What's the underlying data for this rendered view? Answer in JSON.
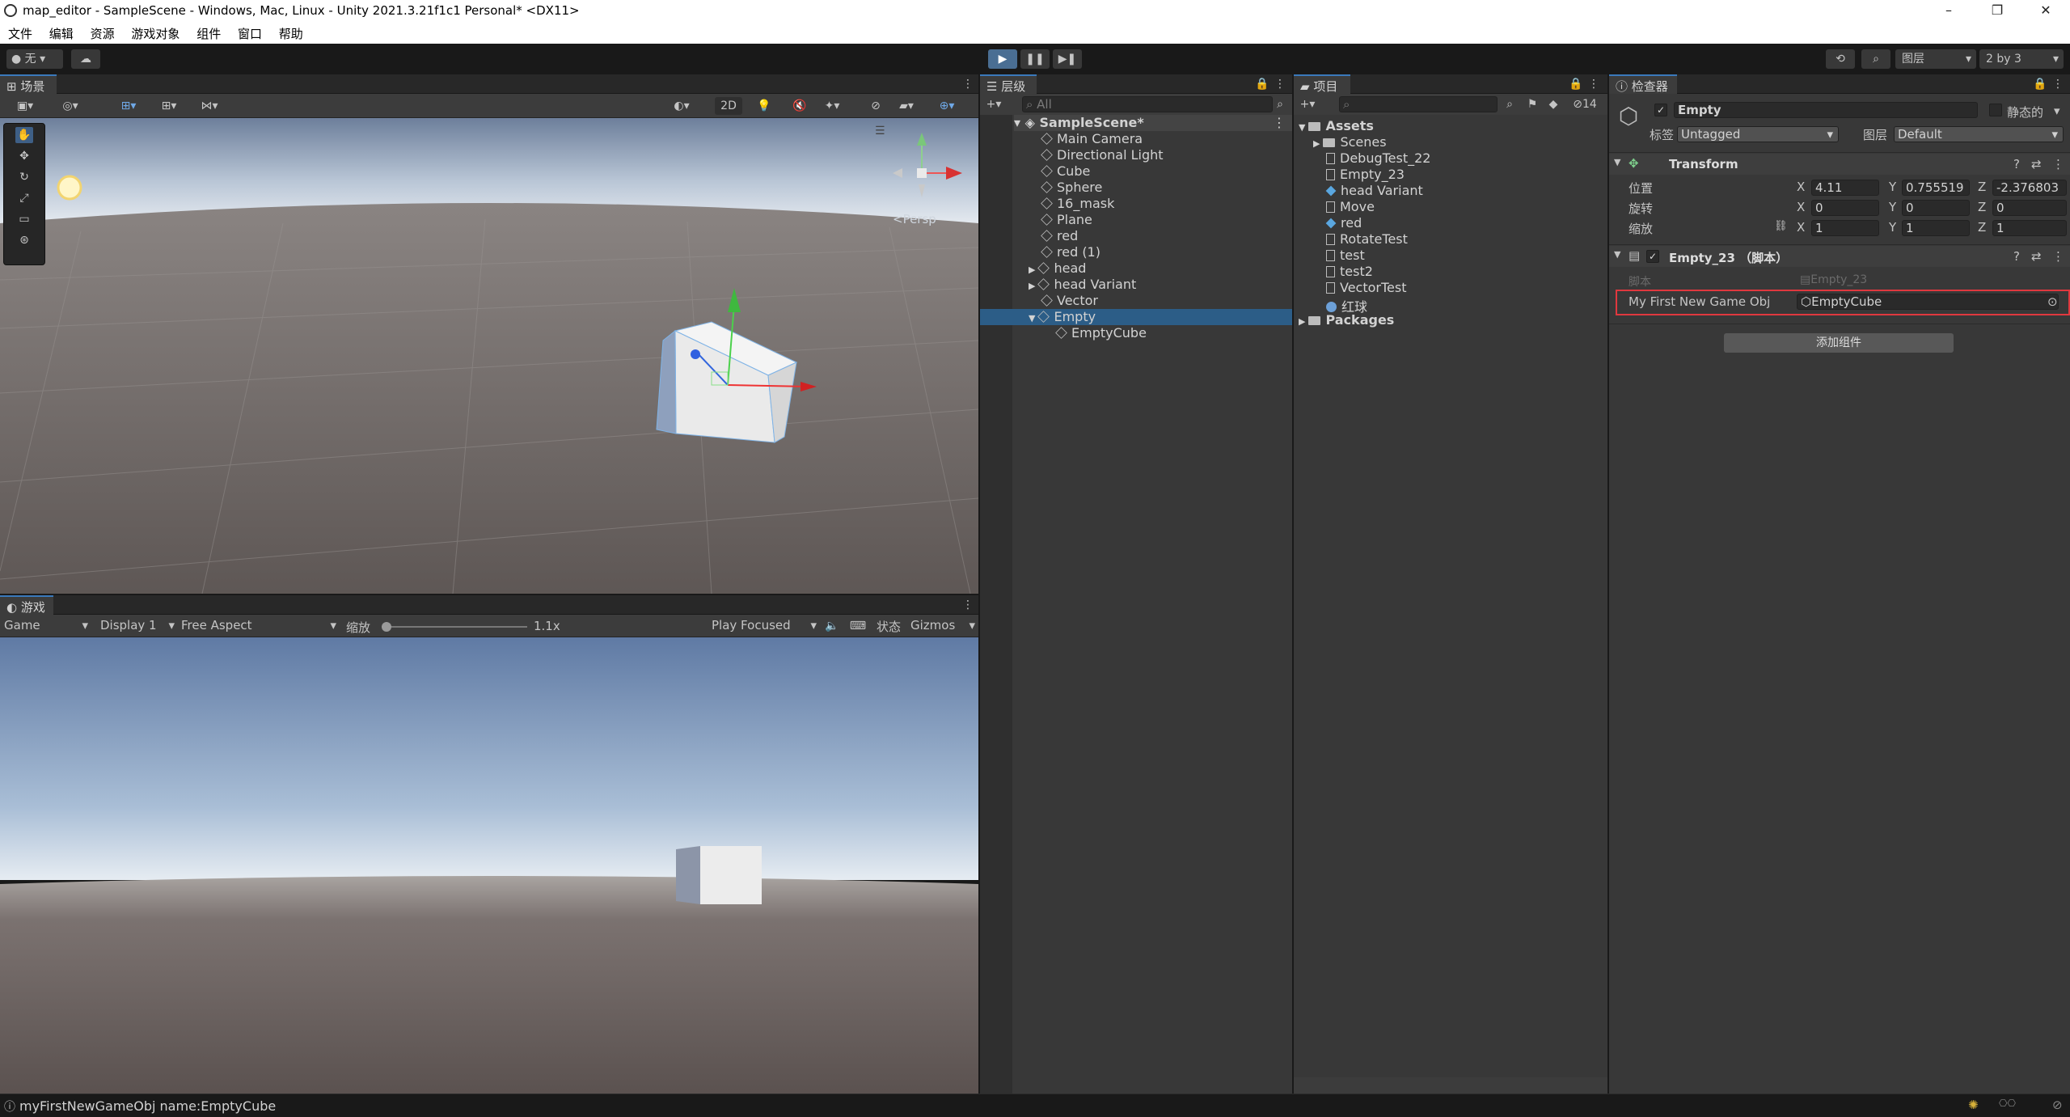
{
  "window": {
    "title": "map_editor - SampleScene - Windows, Mac, Linux - Unity 2021.3.21f1c1 Personal* <DX11>",
    "minimize": "–",
    "restore": "❐",
    "close": "✕"
  },
  "menu": [
    "文件",
    "编辑",
    "资源",
    "游戏对象",
    "组件",
    "窗口",
    "帮助"
  ],
  "toolbar": {
    "account": "无",
    "layers": "图层",
    "layout": "2 by 3"
  },
  "scene": {
    "tab": "场景",
    "btn_2d": "2D",
    "persp": "<Persp"
  },
  "game": {
    "tab": "游戏",
    "game_select": "Game",
    "display": "Display 1",
    "aspect": "Free Aspect",
    "scale_label": "缩放",
    "scale_value": "1.1x",
    "play_mode": "Play Focused",
    "stats": "状态",
    "gizmos": "Gizmos"
  },
  "hierarchy": {
    "tab": "层级",
    "search_placeholder": "All",
    "scene": "SampleScene*",
    "items": [
      "Main Camera",
      "Directional Light",
      "Cube",
      "Sphere",
      "16_mask",
      "Plane",
      "red",
      "red (1)",
      "head",
      "head Variant",
      "Vector",
      "Empty",
      "EmptyCube"
    ]
  },
  "project": {
    "tab": "项目",
    "hidden_count": "14",
    "root": "Assets",
    "items": [
      "Scenes",
      "DebugTest_22",
      "Empty_23",
      "head Variant",
      "Move",
      "red",
      "RotateTest",
      "test",
      "test2",
      "VectorTest",
      "红球"
    ],
    "packages": "Packages"
  },
  "inspector": {
    "tab": "检查器",
    "object_name": "Empty",
    "static_label": "静态的",
    "tag_label": "标签",
    "tag_value": "Untagged",
    "layer_label": "图层",
    "layer_value": "Default",
    "transform": {
      "title": "Transform",
      "position_label": "位置",
      "rotation_label": "旋转",
      "scale_label": "缩放",
      "position": {
        "x": "4.11",
        "y": "0.755519",
        "z": "-2.376803"
      },
      "rotation": {
        "x": "0",
        "y": "0",
        "z": "0"
      },
      "scale": {
        "x": "1",
        "y": "1",
        "z": "1"
      }
    },
    "component": {
      "title": "Empty_23 （脚本）",
      "script_label": "脚本",
      "script_value": "Empty_23",
      "field_label": "My First New Game Obj",
      "field_value": "EmptyCube"
    },
    "add_component": "添加组件"
  },
  "status_bar": {
    "message": "myFirstNewGameObj name:EmptyCube"
  },
  "colors": {
    "accent": "#3a79bb",
    "highlight_box": "#e0383e",
    "selection": "#2c5d87"
  }
}
